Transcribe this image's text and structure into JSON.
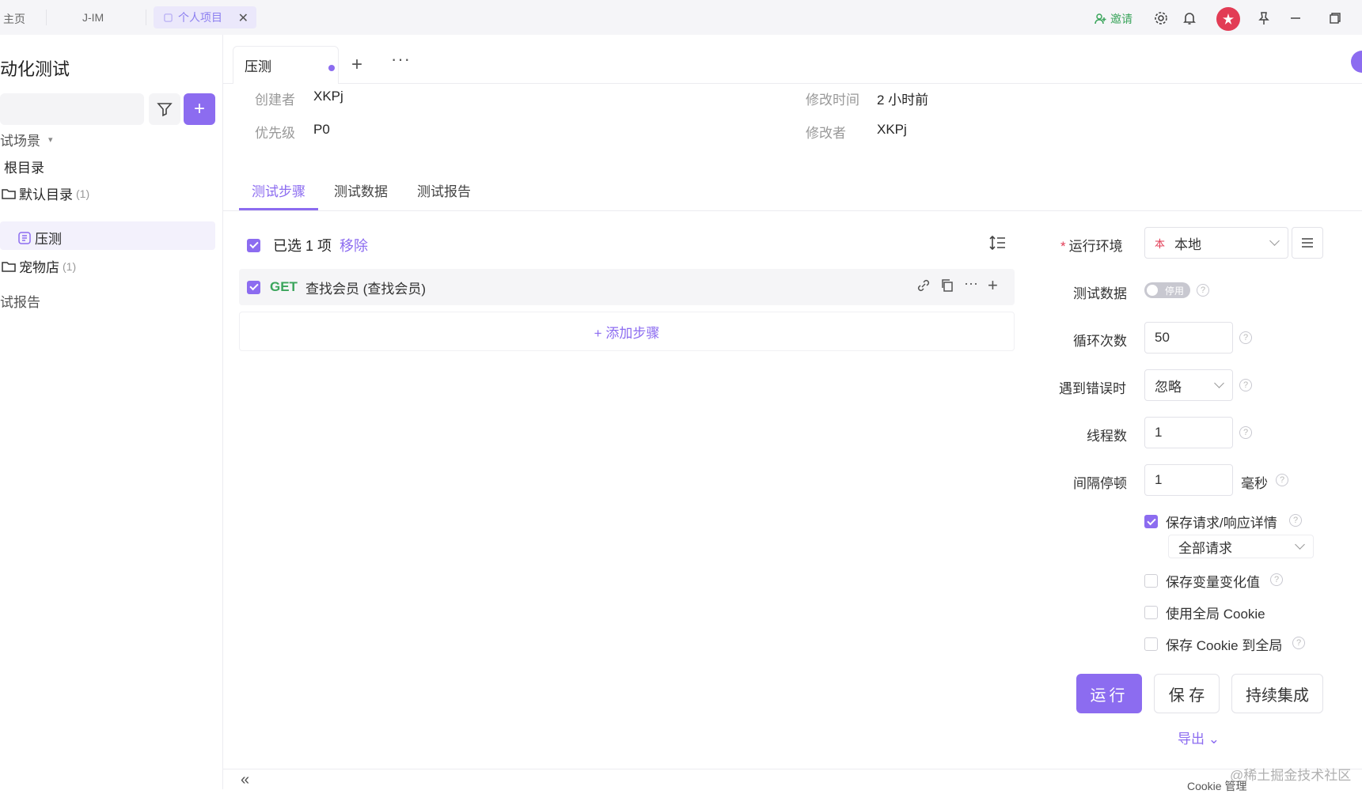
{
  "topbar": {
    "tabs": [
      "主页",
      "J-IM"
    ],
    "active_tab": "个人项目",
    "close": "✕",
    "invite": "邀请",
    "invite_icon": "user-plus-icon",
    "icons": [
      "gear-icon",
      "bell-icon",
      "avatar",
      "pin-icon",
      "minimize-icon",
      "restore-icon"
    ]
  },
  "sidebar": {
    "title": "动化测试",
    "add": "+",
    "section_scenes": "试场景",
    "caret": "▾",
    "root": "根目录",
    "items": [
      {
        "label": "默认目录",
        "count": "(1)"
      },
      {
        "label": "压测"
      },
      {
        "label": "宠物店",
        "count": "(1)"
      }
    ],
    "section_reports": "试报告"
  },
  "tabs": {
    "current": "压测",
    "add": "+",
    "more": "···"
  },
  "meta": {
    "creator_label": "创建者",
    "creator": "XKPj",
    "priority_label": "优先级",
    "priority": "P0",
    "modified_time_label": "修改时间",
    "modified_time": "2 小时前",
    "modifier_label": "修改者",
    "modifier": "XKPj"
  },
  "subtabs": [
    "测试步骤",
    "测试数据",
    "测试报告"
  ],
  "steps": {
    "selected": "已选 1 项",
    "remove": "移除",
    "items": [
      {
        "method": "GET",
        "name": "查找会员 (查找会员)",
        "method_color": "#3ba55c"
      }
    ],
    "add_step": "+ 添加步骤"
  },
  "config": {
    "env_label": "运行环境",
    "env_value": "本地",
    "env_badge": "本",
    "test_data_label": "测试数据",
    "test_data_toggle": "停用",
    "loop_label": "循环次数",
    "loop_value": "50",
    "on_error_label": "遇到错误时",
    "on_error_value": "忽略",
    "threads_label": "线程数",
    "threads_value": "1",
    "interval_label": "间隔停顿",
    "interval_value": "1",
    "interval_unit": "毫秒",
    "save_details": "保存请求/响应详情",
    "save_details_scope": "全部请求",
    "save_vars": "保存变量变化值",
    "use_global_cookie": "使用全局 Cookie",
    "save_cookie_global": "保存 Cookie 到全局",
    "help": "?"
  },
  "actions": {
    "run": "运行",
    "save": "保 存",
    "ci": "持续集成",
    "export": "导出 ⌄"
  },
  "footer": {
    "collapse": "«",
    "cookie": "Cookie 管理",
    "watermark": "@稀土掘金技术社区"
  },
  "colors": {
    "accent": "#8c6cf0",
    "get": "#3ba55c",
    "required": "#e23c55"
  }
}
